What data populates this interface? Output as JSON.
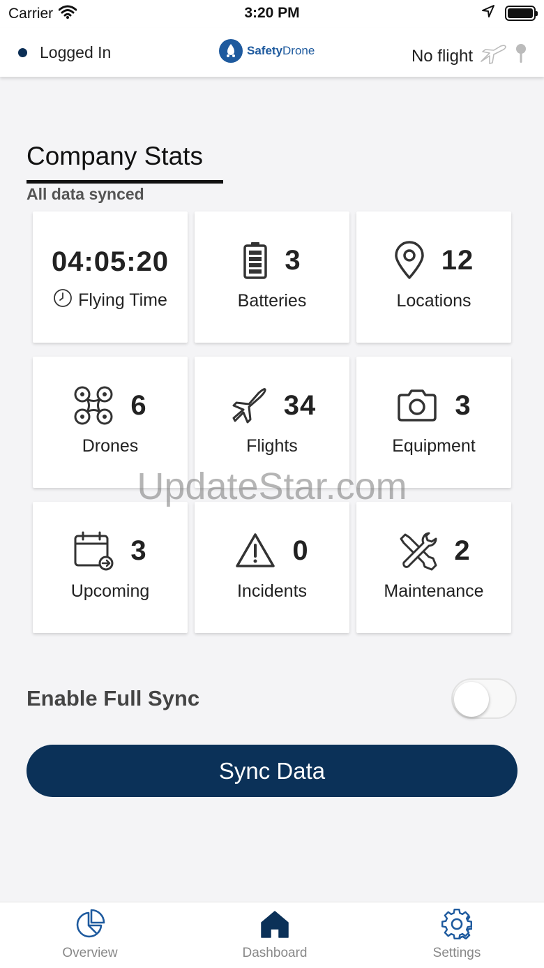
{
  "status_bar": {
    "carrier": "Carrier",
    "time": "3:20 PM"
  },
  "header": {
    "login_status": "Logged In",
    "logo_bold": "Safety",
    "logo_light": "Drone",
    "flight_status": "No flight"
  },
  "section": {
    "title": "Company Stats",
    "sync_status": "All data synced"
  },
  "stats": {
    "flying_time": {
      "value": "04:05:20",
      "label": "Flying Time"
    },
    "batteries": {
      "value": "3",
      "label": "Batteries"
    },
    "locations": {
      "value": "12",
      "label": "Locations"
    },
    "drones": {
      "value": "6",
      "label": "Drones"
    },
    "flights": {
      "value": "34",
      "label": "Flights"
    },
    "equipment": {
      "value": "3",
      "label": "Equipment"
    },
    "upcoming": {
      "value": "3",
      "label": "Upcoming"
    },
    "incidents": {
      "value": "0",
      "label": "Incidents"
    },
    "maintenance": {
      "value": "2",
      "label": "Maintenance"
    }
  },
  "watermark": "UpdateStar.com",
  "full_sync": {
    "label": "Enable Full Sync",
    "enabled": false
  },
  "sync_button": {
    "label": "Sync Data"
  },
  "tabs": [
    {
      "label": "Overview",
      "icon": "pie-chart-icon",
      "active": false
    },
    {
      "label": "Dashboard",
      "icon": "home-icon",
      "active": true
    },
    {
      "label": "Settings",
      "icon": "gear-icon",
      "active": false
    }
  ],
  "colors": {
    "primary": "#0b3158",
    "logo_blue": "#1e5a9e",
    "tab_icon": "#1e5a9e",
    "tab_label": "#888888",
    "background": "#f4f4f6"
  }
}
